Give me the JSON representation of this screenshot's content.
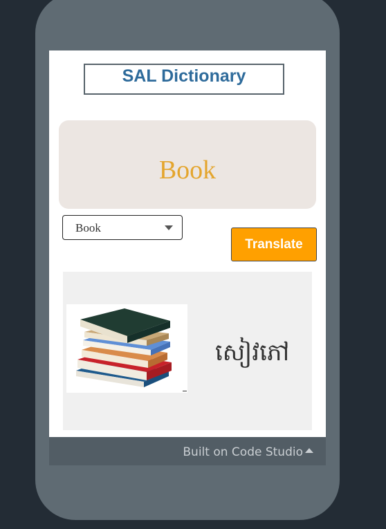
{
  "app": {
    "title": "SAL Dictionary"
  },
  "word_display": {
    "text": "Book",
    "color": "#e4a52d"
  },
  "word_select": {
    "selected": "Book"
  },
  "translate_button": {
    "label": "Translate",
    "color": "#ffa000"
  },
  "result": {
    "image_icon": "stack-of-books-image",
    "translation": "សៀវភៅ"
  },
  "footer": {
    "label": "Built on Code Studio",
    "icon": "caret-up-icon"
  }
}
